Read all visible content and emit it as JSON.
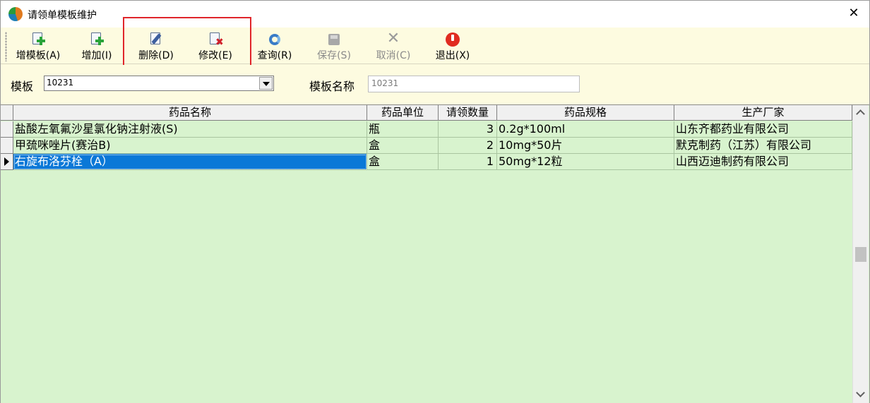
{
  "window": {
    "title": "请领单模板维护",
    "close_symbol": "✕"
  },
  "toolbar": {
    "items": [
      {
        "label": "增模板(A)",
        "icon": "add-template-icon",
        "enabled": true
      },
      {
        "label": "增加(I)",
        "icon": "add-icon",
        "enabled": true
      },
      {
        "label": "删除(D)",
        "icon": "delete-edit-icon",
        "enabled": true
      },
      {
        "label": "修改(E)",
        "icon": "modify-icon",
        "enabled": true
      },
      {
        "label": "查询(R)",
        "icon": "refresh-icon",
        "enabled": true
      },
      {
        "label": "保存(S)",
        "icon": "save-icon",
        "enabled": false
      },
      {
        "label": "取消(C)",
        "icon": "cancel-icon",
        "enabled": false
      },
      {
        "label": "退出(X)",
        "icon": "power-icon",
        "enabled": true
      }
    ]
  },
  "form": {
    "template_label": "模板",
    "template_value": "10231",
    "template_name_label": "模板名称",
    "template_name_value": "10231"
  },
  "grid": {
    "columns": [
      "药品名称",
      "药品单位",
      "请领数量",
      "药品规格",
      "生产厂家"
    ],
    "rows": [
      {
        "name": "盐酸左氧氟沙星氯化钠注射液(S)",
        "unit": "瓶",
        "qty": "3",
        "spec": "0.2g*100ml",
        "maker": "山东齐都药业有限公司"
      },
      {
        "name": "甲巯咪唑片(赛治B)",
        "unit": "盒",
        "qty": "2",
        "spec": "10mg*50片",
        "maker": "默克制药（江苏）有限公司"
      },
      {
        "name": "右旋布洛芬栓（A）",
        "unit": "盒",
        "qty": "1",
        "spec": "50mg*12粒",
        "maker": "山西迈迪制药有限公司"
      }
    ],
    "selected_row": 2
  },
  "colors": {
    "toolbar_bg": "#fdfbe0",
    "grid_bg": "#d8f3ce",
    "selection": "#0a78d7",
    "highlight_box": "#e0262b"
  }
}
